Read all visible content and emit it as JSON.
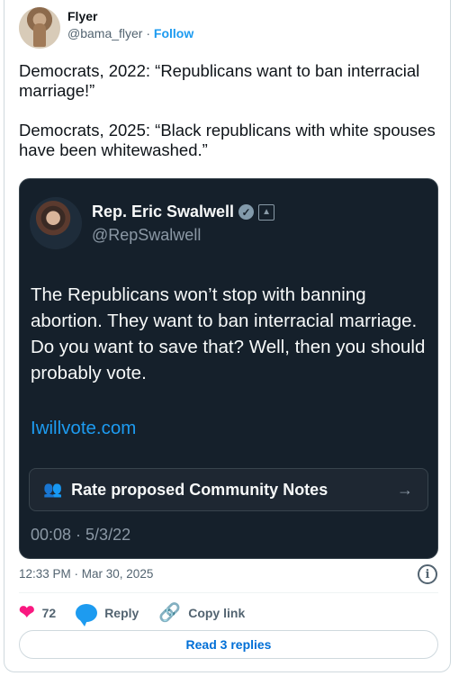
{
  "author": {
    "name": "Flyer",
    "handle": "@bama_flyer",
    "separator": "·",
    "follow": "Follow"
  },
  "tweet": {
    "para1": "Democrats, 2022: “Republicans want to ban interracial marriage!”",
    "para2": "Democrats, 2025: “Black republicans with white spouses have been whitewashed.”"
  },
  "embed": {
    "name": "Rep. Eric Swalwell",
    "handle": "@RepSwalwell",
    "text": "The Republicans won’t stop with banning abortion. They want to ban interracial marriage. Do you want to save that? Well, then you should probably vote.",
    "link": "Iwillvote.com",
    "notes_label": "Rate proposed Community Notes",
    "time": "00:08 · 5/3/22"
  },
  "timestamp": "12:33 PM · Mar 30, 2025",
  "actions": {
    "likes": "72",
    "reply": "Reply",
    "copy_link": "Copy link"
  },
  "read_replies": "Read 3 replies",
  "colors": {
    "like": "#f91880",
    "accent": "#1d9bf0",
    "embed_bg": "#15202b"
  }
}
